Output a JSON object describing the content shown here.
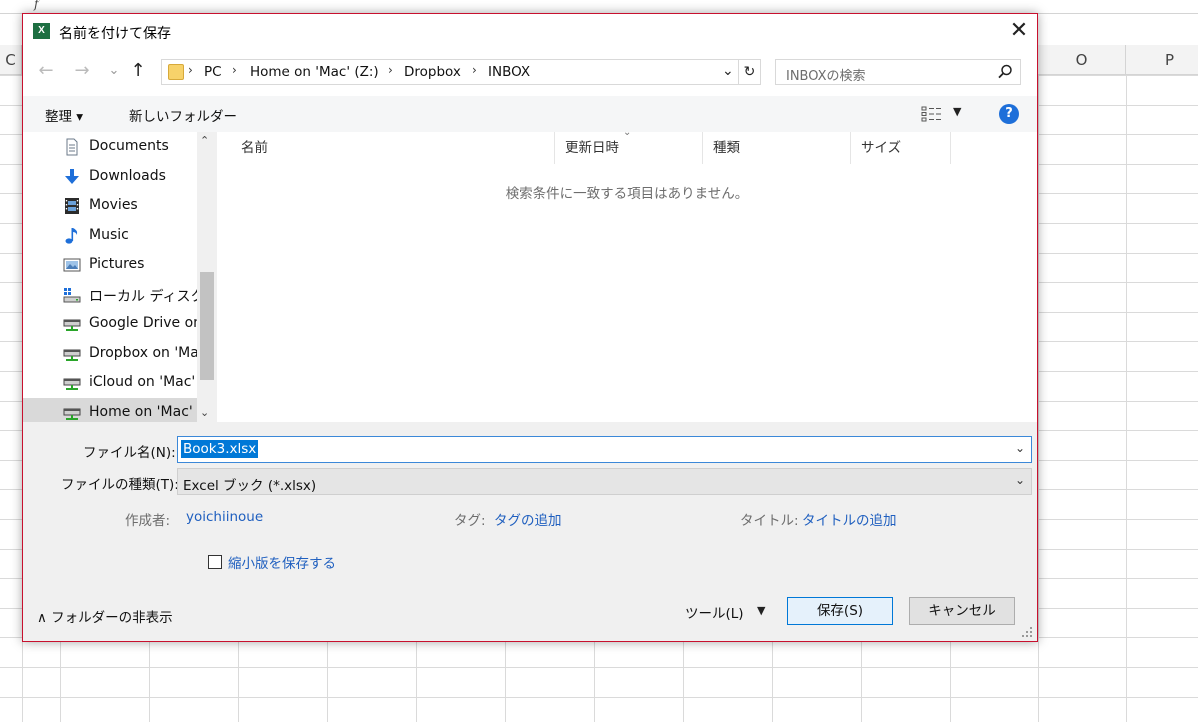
{
  "excel": {
    "fx": "f",
    "columns": [
      "C",
      "O",
      "P"
    ]
  },
  "dialog": {
    "app_icon_text": "X",
    "title": "名前を付けて保存",
    "close_glyph": "✕"
  },
  "nav": {
    "back": "←",
    "forward": "→",
    "recent": "⌄",
    "up": "↑",
    "breadcrumb": [
      "PC",
      "Home on 'Mac' (Z:)",
      "Dropbox",
      "INBOX"
    ],
    "separator": "›",
    "dropdown_glyph": "⌄",
    "refresh_glyph": "↻",
    "search_placeholder": "INBOXの検索"
  },
  "toolbar": {
    "organize": "整理 ▾",
    "new_folder": "新しいフォルダー",
    "view_dropdown": "▼",
    "help": "?"
  },
  "sidebar": {
    "scroll_up": "⌃",
    "scroll_down": "⌄",
    "items": [
      {
        "label": "Documents",
        "icon": "document-icon"
      },
      {
        "label": "Downloads",
        "icon": "download-arrow-icon"
      },
      {
        "label": "Movies",
        "icon": "film-icon"
      },
      {
        "label": "Music",
        "icon": "music-note-icon"
      },
      {
        "label": "Pictures",
        "icon": "picture-icon"
      },
      {
        "label": "ローカル ディスク (C",
        "icon": "local-disk-icon"
      },
      {
        "label": "Google Drive on",
        "icon": "network-drive-icon"
      },
      {
        "label": "Dropbox on 'Ma",
        "icon": "network-drive-icon"
      },
      {
        "label": "iCloud on 'Mac'",
        "icon": "network-drive-icon"
      },
      {
        "label": "Home on 'Mac' (",
        "icon": "network-drive-icon",
        "selected": true
      }
    ]
  },
  "filelist": {
    "columns": [
      "名前",
      "更新日時",
      "種類",
      "サイズ"
    ],
    "sort_glyph": "⌄",
    "empty_message": "検索条件に一致する項目はありません。"
  },
  "form": {
    "filename_label": "ファイル名(N):",
    "filename_value": "Book3.xlsx",
    "filetype_label": "ファイルの種類(T):",
    "filetype_value": "Excel ブック (*.xlsx)",
    "dd_glyph": "⌄",
    "author_label": "作成者:",
    "author_value": "yoichiinoue",
    "tags_label": "タグ:",
    "tags_value": "タグの追加",
    "title_label": "タイトル:",
    "title_value": "タイトルの追加",
    "thumbnail_label": "縮小版を保存する"
  },
  "footer": {
    "hide_folders": "∧  フォルダーの非表示",
    "tools": "ツール(L)",
    "tools_dd": "▼",
    "save": "保存(S)",
    "cancel": "キャンセル"
  }
}
